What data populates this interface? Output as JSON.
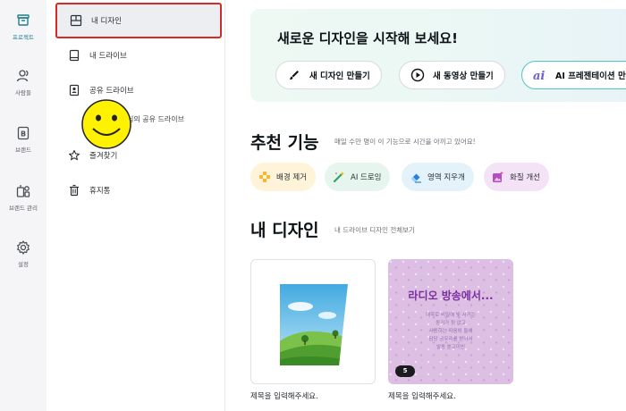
{
  "rail": {
    "items": [
      {
        "label": "프로젝트",
        "icon": "folder-icon"
      },
      {
        "label": "사람들",
        "icon": "people-icon"
      },
      {
        "label": "브랜드",
        "icon": "brand-icon"
      },
      {
        "label": "브랜드 관리",
        "icon": "brand-manage-icon"
      },
      {
        "label": "설정",
        "icon": "gear-icon"
      }
    ]
  },
  "sidebar": {
    "items": [
      {
        "label": "내 디자인",
        "icon": "grid-icon"
      },
      {
        "label": "내 드라이브",
        "icon": "drive-icon"
      },
      {
        "label": "공유 드라이브",
        "icon": "shared-drive-icon"
      },
      {
        "label": "즐겨찾기",
        "icon": "star-icon"
      },
      {
        "label": "휴지통",
        "icon": "trash-icon"
      }
    ],
    "shared_sub": "님의 공유 드라이브"
  },
  "hero": {
    "title": "새로운 디자인을 시작해 보세요!",
    "buttons": [
      {
        "label": "새 디자인 만들기",
        "icon": "brush-icon"
      },
      {
        "label": "새 동영상 만들기",
        "icon": "play-icon"
      },
      {
        "label": "AI 프레젠테이션 만",
        "icon": "ai-icon"
      }
    ]
  },
  "recommend": {
    "title": "추천 기능",
    "subtitle": "매일 수만 명이 이 기능으로 시간을 아끼고 있어요!",
    "chips": [
      {
        "label": "배경 제거",
        "icon": "bg-remove-icon"
      },
      {
        "label": "AI 드로잉",
        "icon": "magic-wand-icon"
      },
      {
        "label": "영역 지우개",
        "icon": "eraser-icon"
      },
      {
        "label": "화질 개선",
        "icon": "enhance-icon"
      }
    ]
  },
  "designs": {
    "title": "내 디자인",
    "subtitle": "내 드라이브 디자인 전체보기",
    "cards": [
      {
        "caption": "제목을 입력해주세요."
      },
      {
        "caption": "제목을 입력해주세요.",
        "heading": "라디오 방송에서...",
        "lines": [
          "대학로 비밀에 빛 사거는",
          "동거가 될 없고",
          "사용하는 따음의 둘에",
          "담당 공우리를 받아서",
          "발동 뿐고미빈"
        ],
        "page_count": "5"
      }
    ]
  },
  "colors": {
    "accent": "#1d7f8a",
    "highlight_border": "#d42a2a",
    "hero_bg": "#eef9f3"
  }
}
